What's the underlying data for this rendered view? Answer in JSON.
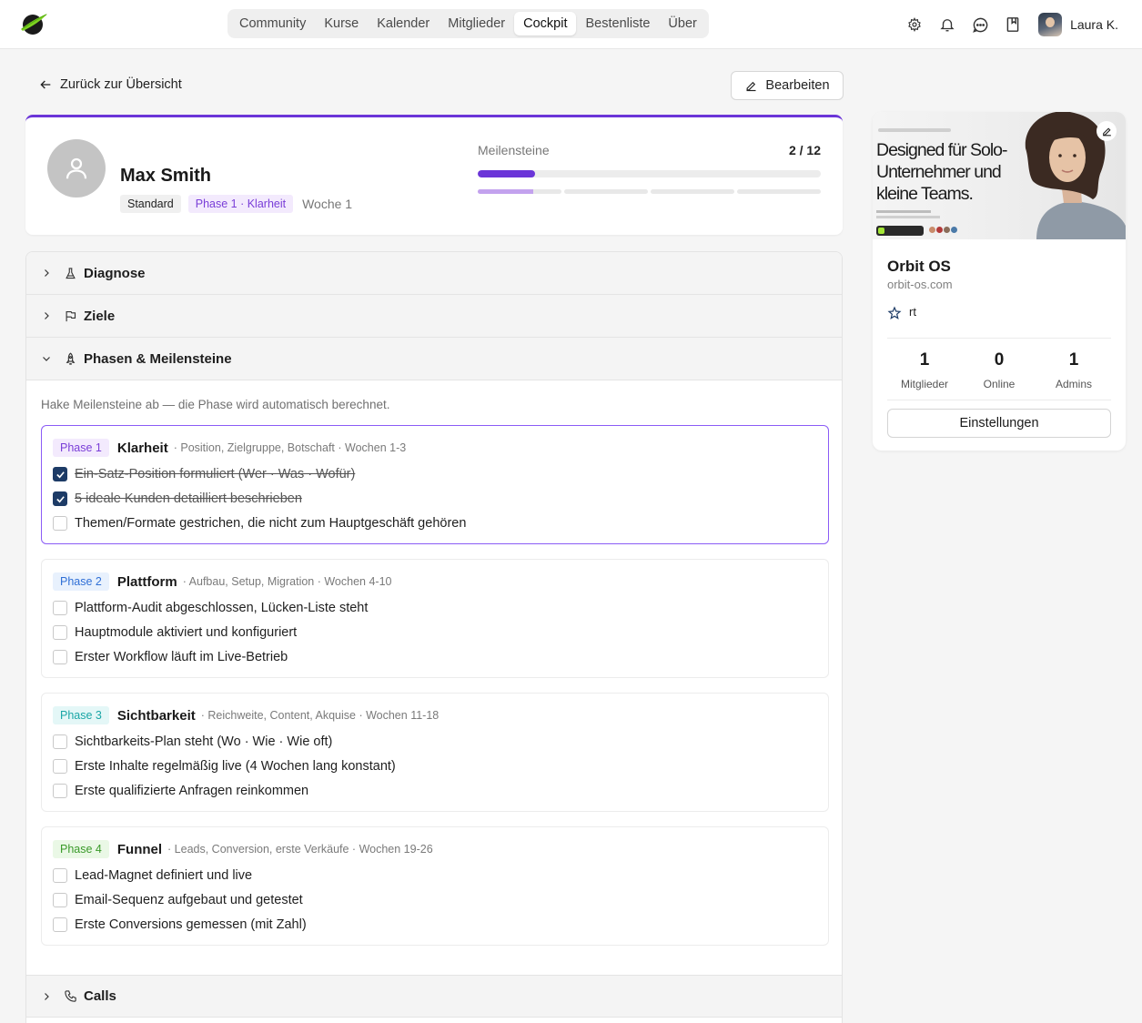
{
  "nav": {
    "tabs": [
      "Community",
      "Kurse",
      "Kalender",
      "Mitglieder",
      "Cockpit",
      "Bestenliste",
      "Über"
    ],
    "active": "Cockpit"
  },
  "user": {
    "name": "Laura K."
  },
  "back_label": "Zurück zur Übersicht",
  "edit_label": "Bearbeiten",
  "profile": {
    "name": "Max Smith",
    "tag_plan": "Standard",
    "tag_phase": "Phase 1 · Klarheit",
    "week": "Woche 1",
    "milestones_label": "Meilensteine",
    "milestones_count": "2 / 12",
    "milestones_done": 2,
    "milestones_total": 12,
    "phase_segments": [
      0.67,
      0,
      0,
      0
    ]
  },
  "sections": {
    "diagnose": "Diagnose",
    "ziele": "Ziele",
    "phasen": "Phasen & Meilensteine",
    "calls": "Calls"
  },
  "phases_hint": "Hake Meilensteine ab — die Phase wird automatisch berechnet.",
  "phases": [
    {
      "badge": "Phase 1",
      "name": "Klarheit",
      "desc": "· Position, Zielgruppe, Botschaft · Wochen 1-3",
      "badge_bg": "#f3eafd",
      "badge_fg": "#7a3ed8",
      "items": [
        {
          "label": "Ein-Satz-Position formuliert (Wer · Was · Wofür)",
          "checked": true
        },
        {
          "label": "5 ideale Kunden detailliert beschrieben",
          "checked": true
        },
        {
          "label": "Themen/Formate gestrichen, die nicht zum Hauptgeschäft gehören",
          "checked": false
        }
      ]
    },
    {
      "badge": "Phase 2",
      "name": "Plattform",
      "desc": "· Aufbau, Setup, Migration · Wochen 4-10",
      "badge_bg": "#e8f1fd",
      "badge_fg": "#2f6fd6",
      "items": [
        {
          "label": "Plattform-Audit abgeschlossen, Lücken-Liste steht",
          "checked": false
        },
        {
          "label": "Hauptmodule aktiviert und konfiguriert",
          "checked": false
        },
        {
          "label": "Erster Workflow läuft im Live-Betrieb",
          "checked": false
        }
      ]
    },
    {
      "badge": "Phase 3",
      "name": "Sichtbarkeit",
      "desc": "· Reichweite, Content, Akquise · Wochen 11-18",
      "badge_bg": "#e4f7f7",
      "badge_fg": "#1aa6a6",
      "items": [
        {
          "label": "Sichtbarkeits-Plan steht (Wo · Wie · Wie oft)",
          "checked": false
        },
        {
          "label": "Erste Inhalte regelmäßig live (4 Wochen lang konstant)",
          "checked": false
        },
        {
          "label": "Erste qualifizierte Anfragen reinkommen",
          "checked": false
        }
      ]
    },
    {
      "badge": "Phase 4",
      "name": "Funnel",
      "desc": "· Leads, Conversion, erste Verkäufe · Wochen 19-26",
      "badge_bg": "#eaf8e6",
      "badge_fg": "#3a9a2a",
      "items": [
        {
          "label": "Lead-Magnet definiert und live",
          "checked": false
        },
        {
          "label": "Email-Sequenz aufgebaut und getestet",
          "checked": false
        },
        {
          "label": "Erste Conversions gemessen (mit Zahl)",
          "checked": false
        }
      ]
    }
  ],
  "org": {
    "hero_headline": "Designed für Solo-Unternehmer und kleine Teams.",
    "name": "Orbit OS",
    "url": "orbit-os.com",
    "rating_text": "rt",
    "stats": [
      {
        "value": "1",
        "label": "Mitglieder"
      },
      {
        "value": "0",
        "label": "Online"
      },
      {
        "value": "1",
        "label": "Admins"
      }
    ],
    "settings_label": "Einstellungen"
  },
  "colors": {
    "accent": "#6b35d8",
    "checkbox_checked": "#1d3b66",
    "active_phase_border": "#8b5cf6"
  },
  "icons": [
    "orbit-logo-icon",
    "gear-icon",
    "bell-icon",
    "chat-icon",
    "bookmark-icon",
    "arrow-left-icon",
    "pencil-icon",
    "user-icon",
    "chevron-right-icon",
    "chevron-down-icon",
    "flask-icon",
    "flag-icon",
    "rocket-icon",
    "phone-icon",
    "star-icon"
  ]
}
